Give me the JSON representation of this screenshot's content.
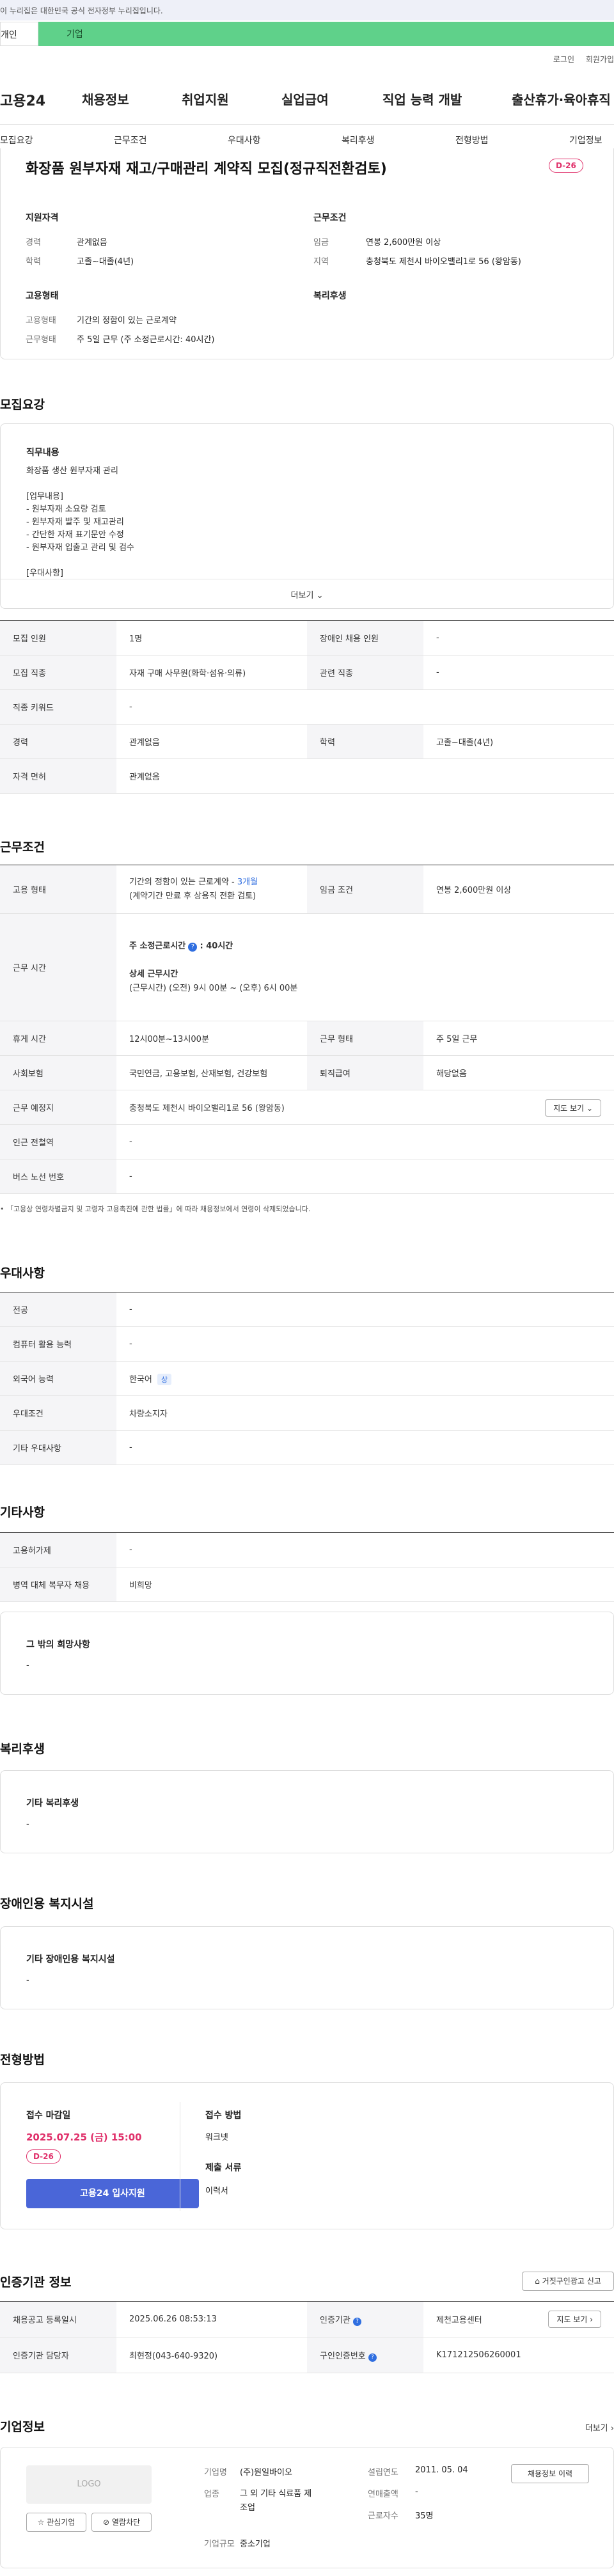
{
  "gov_notice": "이 누리집은 대한민국 공식 전자정부 누리집입니다.",
  "user_tabs": {
    "individual": "개인",
    "corporate": "기업"
  },
  "top_links": [
    "로그인",
    "회원가입"
  ],
  "gnb": {
    "logo": "고용24",
    "items": [
      "채용정보",
      "취업지원",
      "실업급여",
      "직업 능력 개발",
      "출산휴가·육아휴직"
    ]
  },
  "subnav": [
    "모집요강",
    "근무조건",
    "우대사항",
    "복리후생",
    "전형방법",
    "기업정보"
  ],
  "job": {
    "title": "화장품 원부자재 재고/구매관리 계약직 모집(정규직전환검토)",
    "dday": "D-26",
    "qualification_title": "지원자격",
    "career_label": "경력",
    "career_value": "관계없음",
    "education_label": "학력",
    "education_value": "고졸~대졸(4년)",
    "conditions_title": "근무조건",
    "wage_label": "임금",
    "wage_value": "연봉 2,600만원 이상",
    "region_label": "지역",
    "region_value": "충청북도 제천시 바이오밸리1로 56 (왕암동)",
    "employment_title": "고용형태",
    "emp_type_label": "고용형태",
    "emp_type_value": "기간의 정함이 있는 근로계약",
    "work_form_label": "근무형태",
    "work_form_value": "주 5일 근무 (주 소정근로시간: 40시간)",
    "welfare_title": "복리후생"
  },
  "recruit": {
    "title": "모집요강",
    "duty_heading": "직무내용",
    "duty_lines": [
      "화장품 생산 원부자재 관리",
      "",
      "[업무내용]",
      "- 원부자재 소요량 검토",
      "- 원부자재 발주 및 재고관리",
      "- 간단한 자재 표기문안 수정",
      "- 원부자재 입출고 관리 및 검수",
      "",
      "[우대사항]"
    ],
    "more": "더보기",
    "rows": [
      {
        "l1": "모집 인원",
        "v1": "1명",
        "l2": "장애인 채용 인원",
        "v2": "-"
      },
      {
        "l1": "모집 직종",
        "v1": "자재 구매 사무원(화학·섬유·의류)",
        "l2": "관련 직종",
        "v2": "-"
      },
      {
        "l1": "직종 키워드",
        "v1": "-"
      },
      {
        "l1": "경력",
        "v1": "관계없음",
        "l2": "학력",
        "v2": "고졸~대졸(4년)"
      },
      {
        "l1": "자격 면허",
        "v1": "관계없음"
      }
    ]
  },
  "work": {
    "title": "근무조건",
    "emp_label": "고용 형태",
    "emp_line1": "기간의 정함이 있는 근로계약 - ",
    "emp_period": "3개월",
    "emp_line2": "(계약기간 만료 후 상용직 전환 검토)",
    "wage_label": "임금 조건",
    "wage_value": "연봉 2,600만원 이상",
    "hours_label": "근무 시간",
    "hours_sub1": "주 소정근로시간",
    "hours_sub1_value": ": 40시간",
    "hours_sub2": "상세 근무시간",
    "hours_detail": "(근무시간) (오전) 9시 00분 ~ (오후) 6시 00분",
    "rows": [
      {
        "l1": "휴게 시간",
        "v1": "12시00분~13시00분",
        "l2": "근무 형태",
        "v2": "주 5일 근무"
      },
      {
        "l1": "사회보험",
        "v1": "국민연금, 고용보험, 산재보험, 건강보험",
        "l2": "퇴직급여",
        "v2": "해당없음"
      }
    ],
    "place_label": "근무 예정지",
    "place_value": "충청북도 제천시 바이오밸리1로 56 (왕암동)",
    "map_btn": "지도 보기",
    "station_label": "인근 전철역",
    "station_value": "-",
    "bus_label": "버스 노선 번호",
    "bus_value": "-",
    "note": "「고용상 연령차별금지 및 고령자 고용촉진에 관한 법률」에 따라 채용정보에서 연령이 삭제되었습니다."
  },
  "preferred": {
    "title": "우대사항",
    "rows": [
      {
        "l": "전공",
        "v": "-"
      },
      {
        "l": "컴퓨터 활용 능력",
        "v": "-"
      },
      {
        "l": "외국어 능력",
        "v": "한국어",
        "badge": "상"
      },
      {
        "l": "우대조건",
        "v": "차량소지자"
      },
      {
        "l": "기타 우대사항",
        "v": "-"
      }
    ]
  },
  "other": {
    "title": "기타사항",
    "rows": [
      {
        "l": "고용허가제",
        "v": "-"
      },
      {
        "l": "병역 대체 복무자 채용",
        "v": "비희망"
      }
    ],
    "box_title": "그 밖의 희망사항",
    "box_value": "-"
  },
  "welfare": {
    "title": "복리후생",
    "box_title": "기타 복리후생",
    "box_value": "-"
  },
  "disabled": {
    "title": "장애인용 복지시설",
    "box_title": "기타 장애인용 복지시설",
    "box_value": "-"
  },
  "selection": {
    "title": "전형방법",
    "deadline_label": "접수 마감일",
    "deadline": "2025.07.25 (금) 15:00",
    "dday": "D-26",
    "apply_btn": "고용24 입사지원",
    "method_label": "접수 방법",
    "method_value": "워크넷",
    "docs_label": "제출 서류",
    "docs_value": "이력서"
  },
  "cert": {
    "title": "인증기관 정보",
    "report_btn": "거짓구인광고 신고",
    "rows": [
      {
        "l1": "채용공고 등록일시",
        "v1": "2025.06.26 08:53:13",
        "l2": "인증기관",
        "v2": "제천고용센터"
      },
      {
        "l1": "인증기관 담당자",
        "v1": "최현정(043-640-9320)",
        "l2": "구인인증번호",
        "v2": "K171212506260001"
      }
    ],
    "map_btn": "지도 보기"
  },
  "company": {
    "title": "기업정보",
    "more": "더보기",
    "logo": "LOGO",
    "fav_btn": "관심기업",
    "block_btn": "열람차단",
    "name_label": "기업명",
    "name_value": "(주)원일바이오",
    "industry_label": "업종",
    "industry_value": "그 외 기타 식료품 제조업",
    "size_label": "기업규모",
    "size_value": "중소기업",
    "founded_label": "설립연도",
    "founded_value": "2011. 05. 04",
    "sales_label": "연매출액",
    "sales_value": "-",
    "employees_label": "근로자수",
    "employees_value": "35명",
    "history_btn": "채용정보 이력"
  }
}
